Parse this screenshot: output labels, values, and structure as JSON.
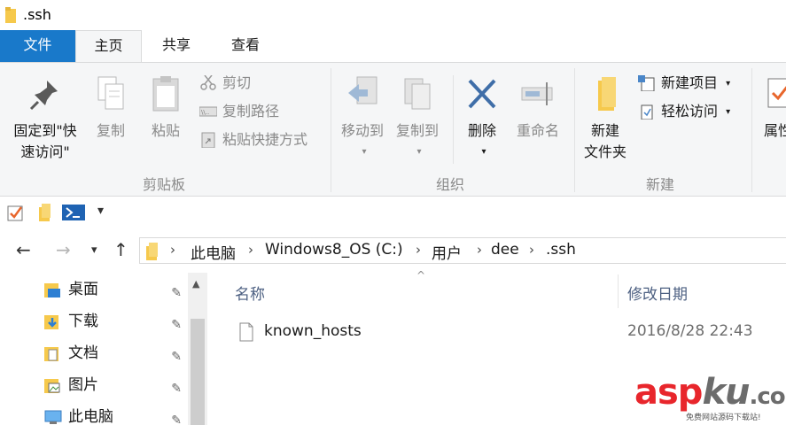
{
  "window": {
    "title": ".ssh"
  },
  "tabs": [
    {
      "label": "文件"
    },
    {
      "label": "主页"
    },
    {
      "label": "共享"
    },
    {
      "label": "查看"
    }
  ],
  "ribbon": {
    "clipboard": {
      "label": "剪贴板",
      "pin_quick_access": {
        "line1": "固定到\"快",
        "line2": "速访问\""
      },
      "copy": "复制",
      "paste": "粘贴",
      "cut": "剪切",
      "copy_path": "复制路径",
      "paste_shortcut": "粘贴快捷方式"
    },
    "organize": {
      "label": "组织",
      "move_to": "移动到",
      "copy_to": "复制到",
      "delete": "删除",
      "rename": "重命名"
    },
    "new": {
      "label": "新建",
      "new_folder": {
        "line1": "新建",
        "line2": "文件夹"
      },
      "new_item": "新建项目",
      "easy_access": "轻松访问"
    },
    "open": {
      "properties": "属性"
    }
  },
  "breadcrumb": [
    "此电脑",
    "Windows8_OS (C:)",
    "用户",
    "dee",
    ".ssh"
  ],
  "nav_pane": [
    {
      "label": "桌面",
      "icon": "desktop-folder-icon"
    },
    {
      "label": "下载",
      "icon": "downloads-folder-icon"
    },
    {
      "label": "文档",
      "icon": "documents-folder-icon"
    },
    {
      "label": "图片",
      "icon": "pictures-folder-icon"
    },
    {
      "label": "此电脑",
      "icon": "computer-icon"
    }
  ],
  "columns": {
    "name": "名称",
    "modified": "修改日期"
  },
  "files": [
    {
      "name": "known_hosts",
      "modified": "2016/8/28 22:43"
    }
  ],
  "watermark": {
    "text_a": "asp",
    "text_b": "ku",
    "text_c": ".com",
    "sub": "免费网站源码下载站!"
  },
  "colors": {
    "file_tab": "#1979ca",
    "ribbon_bg": "#f5f6f7",
    "folder": "#f6c94c",
    "delete_x": "#3f6ea8"
  }
}
